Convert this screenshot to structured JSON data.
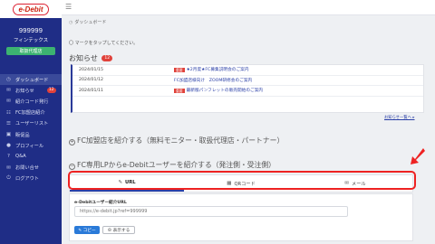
{
  "sidebar": {
    "logo_text": "e-Debit",
    "user_id": "999999",
    "company": "フィンテックス",
    "badge": "取扱代理店",
    "items": [
      {
        "label": "ダッシュボード",
        "icon": "gauge-icon",
        "glyph": "◷"
      },
      {
        "label": "お知らせ",
        "icon": "chat-icon",
        "glyph": "✉",
        "badge": "12"
      },
      {
        "label": "紹介コード発行",
        "icon": "chat-icon",
        "glyph": "✉"
      },
      {
        "label": "FC加盟店紹介",
        "icon": "org-icon",
        "glyph": "☷"
      },
      {
        "label": "ユーザーリスト",
        "icon": "list-icon",
        "glyph": "☰"
      },
      {
        "label": "販促品",
        "icon": "box-icon",
        "glyph": "▣"
      },
      {
        "label": "プロフィール",
        "icon": "user-icon",
        "glyph": "●"
      },
      {
        "label": "Q&A",
        "icon": "qa-icon",
        "glyph": "?"
      },
      {
        "label": "お問い合せ",
        "icon": "mail-icon",
        "glyph": "✉"
      },
      {
        "label": "ログアウト",
        "icon": "logout-icon",
        "glyph": "⏻"
      }
    ]
  },
  "breadcrumb": "ダッシュボード",
  "hint": "〇 マークをタップしてください。",
  "news": {
    "title": "お知らせ",
    "count": "12",
    "rows": [
      {
        "date": "2024/01/15",
        "tag": "重要",
        "text": "★2月度★FC募集説明会のご案内"
      },
      {
        "date": "2024/01/12",
        "tag": "",
        "text": "FC加盟店様向け　ZOOM研修会のご案内"
      },
      {
        "date": "2024/01/11",
        "tag": "重要",
        "text": "最新版パンフレットの販売開始のご案内"
      }
    ],
    "more": "お知らせ一覧へ ▸"
  },
  "section_b": "FC加盟店を紹介する（無料モニター・取扱代理店・パートナー）",
  "section_c": "FC専用LPからe-Debitユーザーを紹介する（発注側・受注側）",
  "tabs": [
    {
      "label": "URL",
      "icon": "link-icon",
      "glyph": "✎"
    },
    {
      "label": "QRコード",
      "icon": "qr-icon",
      "glyph": "▦"
    },
    {
      "label": "メール",
      "icon": "mail-icon",
      "glyph": "✉"
    }
  ],
  "panel": {
    "label": "e-Debitユーザー紹介URL",
    "url_placeholder": "https://e-debit.jp?ref=999999",
    "copy": "✎ コピー",
    "show": "⊕ 表示する"
  },
  "colors": {
    "sidebar": "#1f2d86",
    "highlight": "#ee2222",
    "accent": "#2a3fa7",
    "badge": "#e0413a"
  }
}
